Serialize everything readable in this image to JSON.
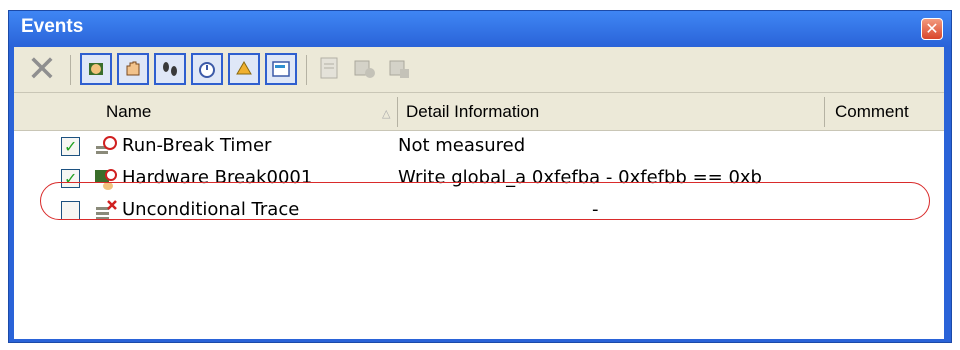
{
  "window": {
    "title": "Events",
    "close_label": "✕"
  },
  "toolbar": {
    "delete_label": "✕",
    "buttons": [
      {
        "icon": "hardware-break-icon"
      },
      {
        "icon": "software-break-icon"
      },
      {
        "icon": "trace-icon"
      },
      {
        "icon": "timer-icon"
      },
      {
        "icon": "point-trace-icon"
      },
      {
        "icon": "performance-icon"
      }
    ],
    "disabled_buttons": [
      {
        "icon": "edit-condition-icon"
      },
      {
        "icon": "enable-icon"
      },
      {
        "icon": "disable-icon"
      }
    ]
  },
  "table": {
    "columns": [
      "Name",
      "Detail Information",
      "Comment"
    ],
    "rows": [
      {
        "checked": true,
        "icon": "run-break-timer-icon",
        "name": "Run-Break Timer",
        "detail": "Not measured",
        "comment": ""
      },
      {
        "checked": true,
        "icon": "hardware-break-icon",
        "name": "Hardware Break0001",
        "detail": "Write  global_a 0xfefba - 0xfefbb == 0xb",
        "comment": ""
      },
      {
        "checked": false,
        "icon": "unconditional-trace-icon",
        "name": "Unconditional Trace",
        "detail": "-",
        "comment": ""
      }
    ]
  },
  "colors": {
    "titlebar": "#2a63d8",
    "highlight": "#d92b2b",
    "check": "#21a121"
  }
}
